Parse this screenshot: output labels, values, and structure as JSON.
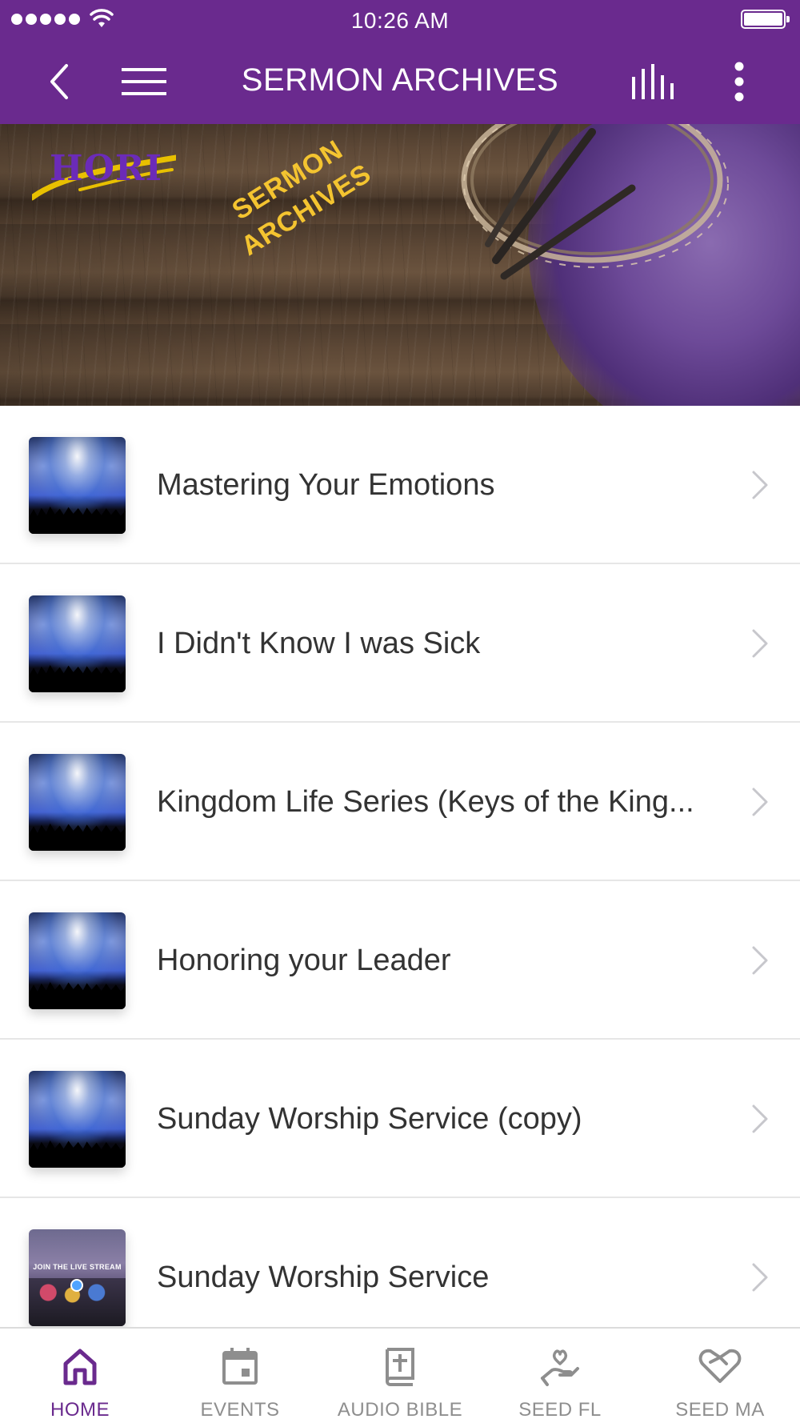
{
  "status_bar": {
    "time": "10:26 AM"
  },
  "nav": {
    "title": "SERMON ARCHIVES"
  },
  "hero": {
    "logo_text": "HORI",
    "caption_line1": "SERMON",
    "caption_line2": "ARCHIVES"
  },
  "list": {
    "items": [
      {
        "title": "Mastering Your Emotions"
      },
      {
        "title": "I Didn't Know I was Sick"
      },
      {
        "title": "Kingdom Life Series (Keys of the King..."
      },
      {
        "title": "Honoring your Leader"
      },
      {
        "title": "Sunday Worship Service (copy)"
      },
      {
        "title": "Sunday Worship Service",
        "thumb_text": "JOIN THE LIVE STREAM"
      }
    ]
  },
  "tabs": [
    {
      "label": "HOME",
      "icon": "home-icon",
      "active": true
    },
    {
      "label": "EVENTS",
      "icon": "calendar-icon"
    },
    {
      "label": "AUDIO BIBLE",
      "icon": "bible-icon"
    },
    {
      "label": "SEED FL",
      "icon": "hand-heart-icon"
    },
    {
      "label": "SEED MA",
      "icon": "handshake-heart-icon"
    }
  ],
  "colors": {
    "brand": "#6a2a8e",
    "hero_caption": "#f4c430",
    "tab_inactive": "#8e8e8e"
  }
}
